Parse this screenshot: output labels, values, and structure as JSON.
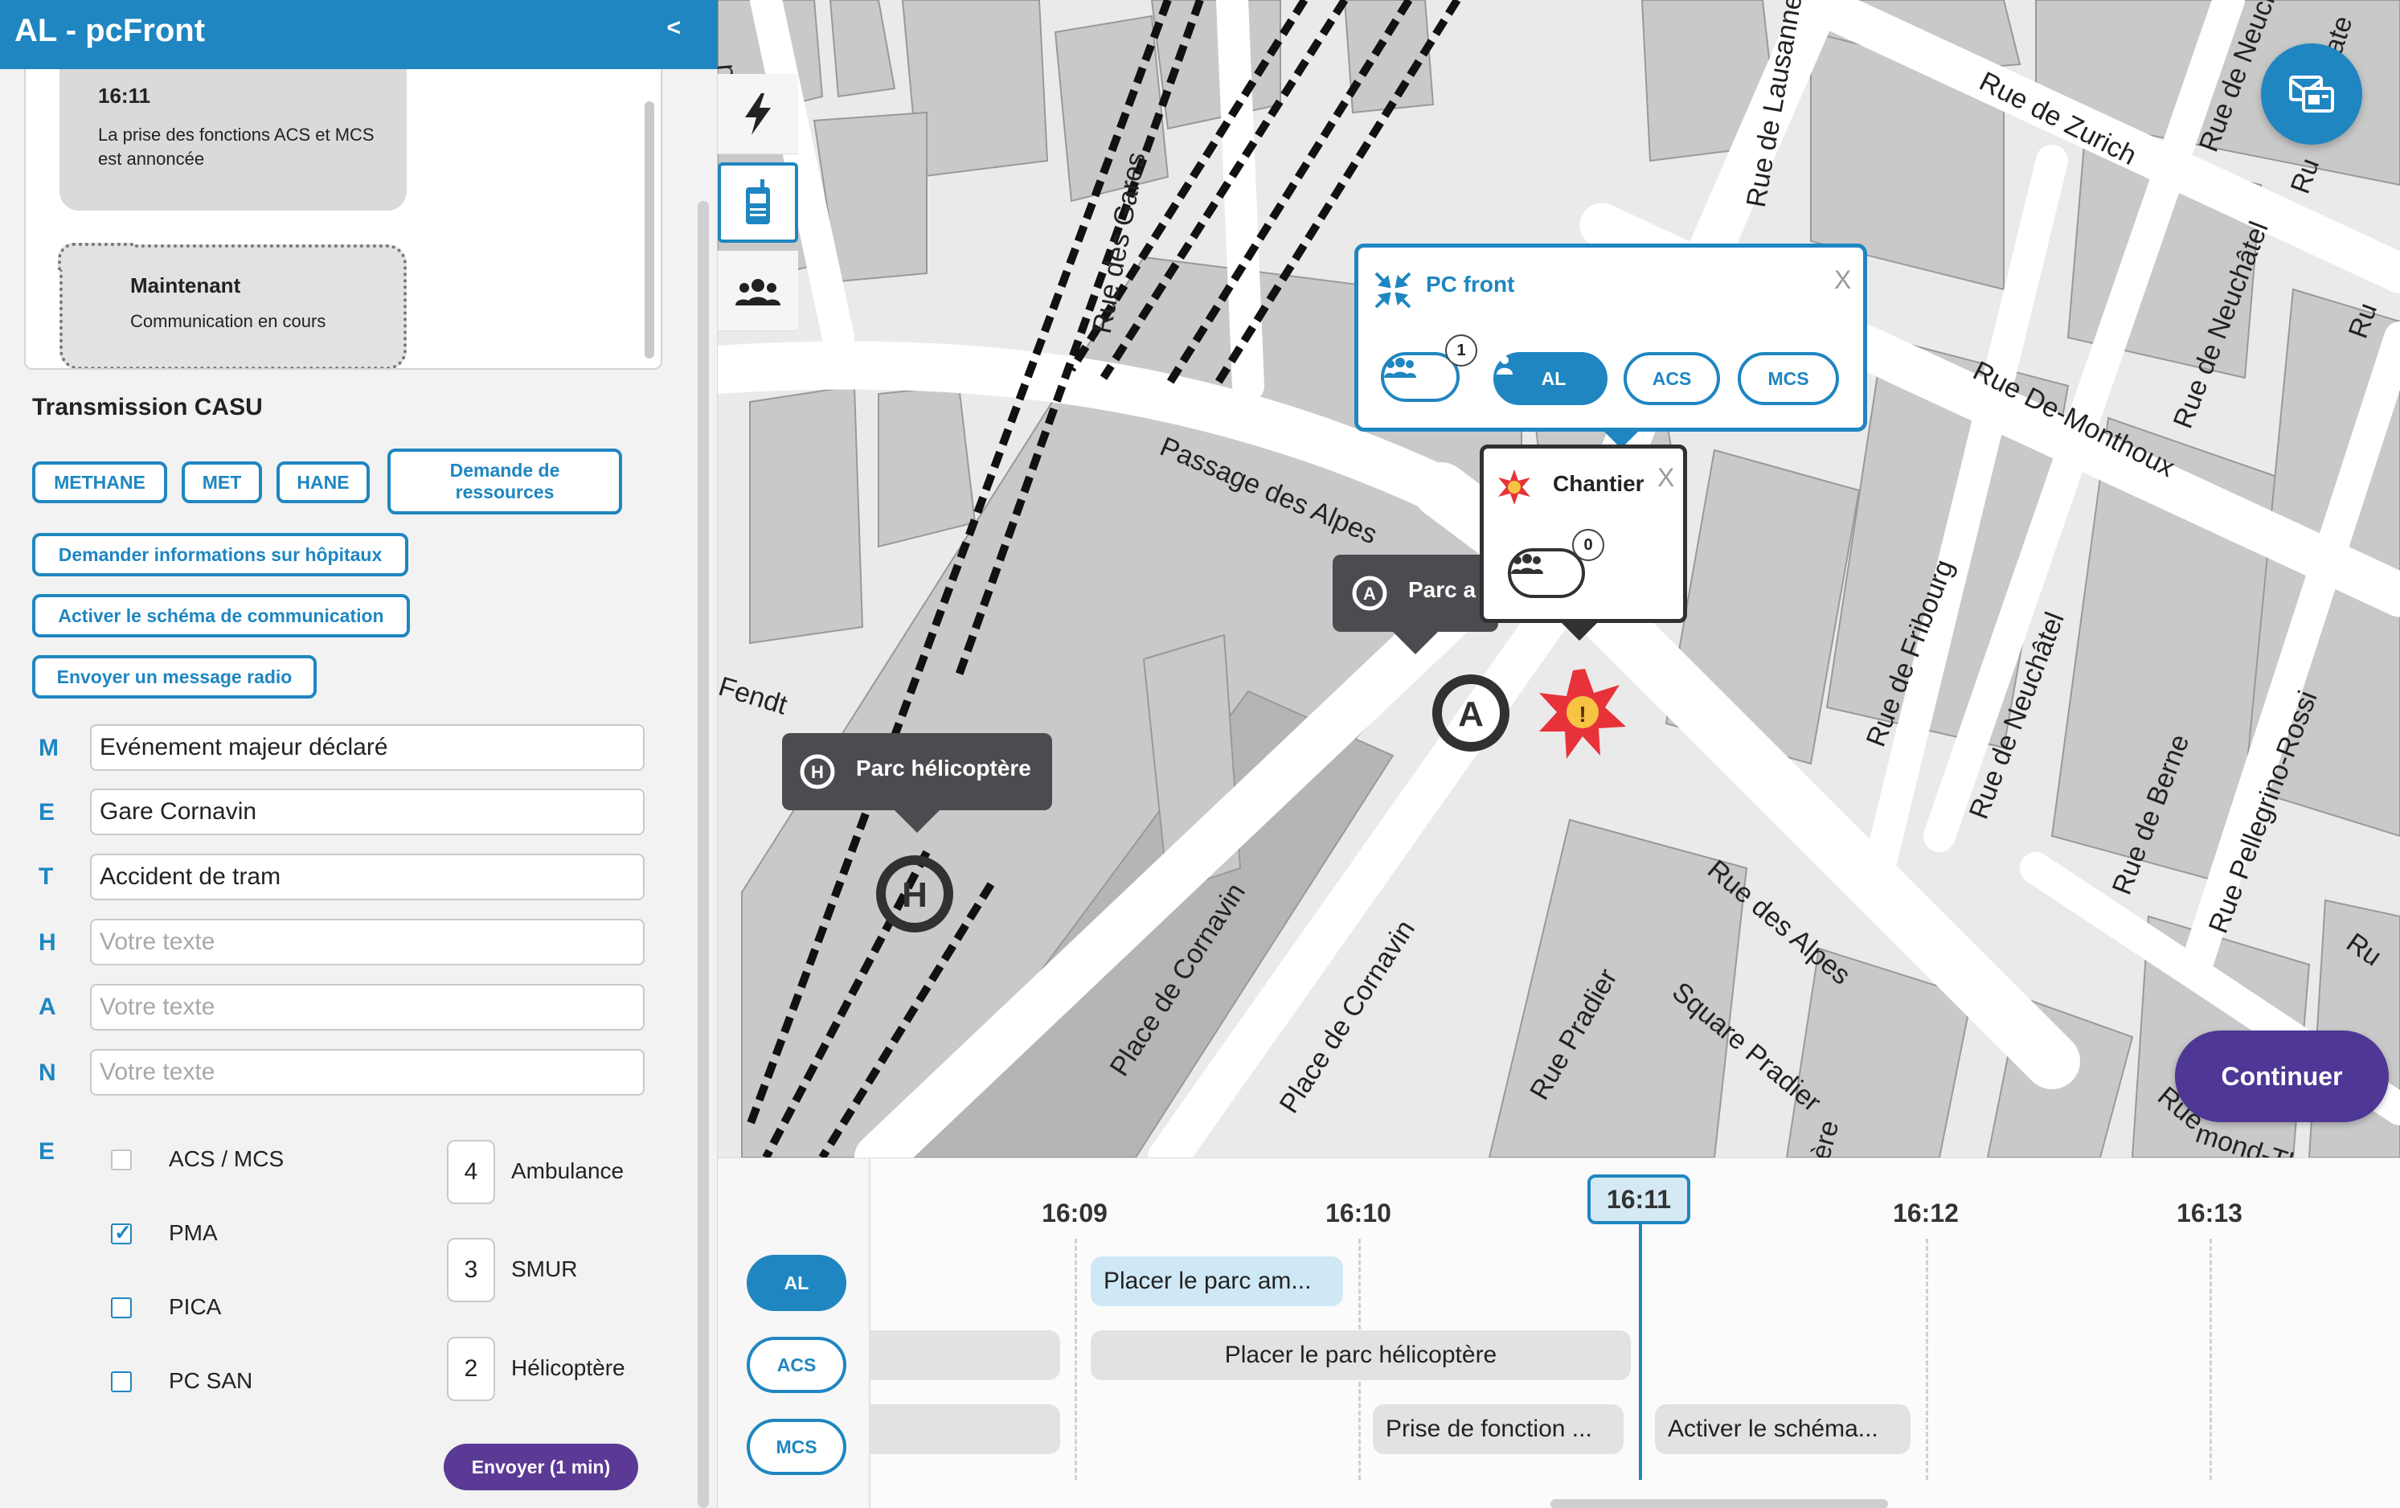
{
  "app": {
    "title": "AL - pcFront",
    "collapse_label": "<"
  },
  "chat": {
    "messages": [
      {
        "time": "16:11",
        "text": "La prise des fonctions ACS et MCS est annoncée"
      },
      {
        "time": "Maintenant",
        "text": "Communication en cours"
      }
    ]
  },
  "transmission": {
    "title": "Transmission CASU",
    "buttons": [
      "METHANE",
      "MET",
      "HANE",
      "Demande de ressources"
    ],
    "actions": [
      "Demander informations sur hôpitaux",
      "Activer le schéma de communication",
      "Envoyer un message radio"
    ]
  },
  "methane": {
    "rows": [
      {
        "letter": "M",
        "value": "Evénement majeur déclaré",
        "placeholder": "Votre texte"
      },
      {
        "letter": "E",
        "value": "Gare Cornavin",
        "placeholder": "Votre texte"
      },
      {
        "letter": "T",
        "value": "Accident de tram",
        "placeholder": "Votre texte"
      },
      {
        "letter": "H",
        "value": "",
        "placeholder": "Votre texte"
      },
      {
        "letter": "A",
        "value": "",
        "placeholder": "Votre texte"
      },
      {
        "letter": "N",
        "value": "",
        "placeholder": "Votre texte"
      }
    ],
    "e_letter": "E",
    "checkboxes": [
      {
        "label": "ACS / MCS",
        "checked": false,
        "disabled": true
      },
      {
        "label": "PMA",
        "checked": true,
        "disabled": false
      },
      {
        "label": "PICA",
        "checked": false,
        "disabled": false
      },
      {
        "label": "PC SAN",
        "checked": false,
        "disabled": false
      }
    ],
    "resources": [
      {
        "qty": "4",
        "label": "Ambulance"
      },
      {
        "qty": "3",
        "label": "SMUR"
      },
      {
        "qty": "2",
        "label": "Hélicoptère"
      }
    ],
    "send_label": "Envoyer (1 min)"
  },
  "map": {
    "streets": [
      "Rue des Gares",
      "Passage des Alpes",
      "Rue de Lausanne",
      "Rue de Zurich",
      "Rue De-Monthoux",
      "Rue de Neuchâtel",
      "Rue de Neuchâtel",
      "Rue de Fribourg",
      "Rue de Neuchâtel",
      "Rue de Berne",
      "Rue Pellegrino-Rossi",
      "Rue des Alpes",
      "Square Pradier",
      "Rue Pradier",
      "Place de Cornavin",
      "Place de Cornavin",
      "Fendt",
      "ntbrillar",
      "Chate",
      "Ru",
      "Ru",
      "Ru",
      "Rue",
      "mond-Th",
      "ière"
    ],
    "helipad_label": "Parc hélicoptère",
    "ambulance_label": "Parc a",
    "pc_front": {
      "title": "PC front",
      "close": "X",
      "badge": "1",
      "pills": [
        "AL",
        "ACS",
        "MCS"
      ]
    },
    "chantier": {
      "title": "Chantier",
      "close": "X",
      "badge": "0"
    },
    "continue_label": "Continuer"
  },
  "timeline": {
    "times": [
      "16:09",
      "16:10",
      "16:11",
      "16:12",
      "16:13"
    ],
    "current": "16:11",
    "rows": [
      "AL",
      "ACS",
      "MCS"
    ],
    "tasks": [
      {
        "row": "AL",
        "label": "Placer le parc am..."
      },
      {
        "row": "ACS",
        "label": ""
      },
      {
        "row": "ACS",
        "label": "Placer le parc hélicoptère"
      },
      {
        "row": "MCS",
        "label": ""
      },
      {
        "row": "MCS",
        "label": "Prise de fonction ..."
      },
      {
        "row": "MCS",
        "label": "Activer le schéma..."
      }
    ]
  },
  "colors": {
    "accent": "#1f86c1",
    "purple": "#4e3795",
    "dark_popup": "#4a4c4f"
  }
}
